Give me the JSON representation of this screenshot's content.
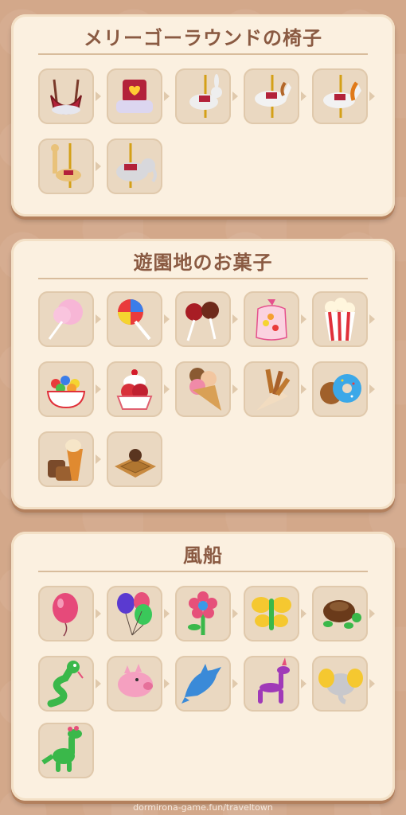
{
  "sections": [
    {
      "title": "メリーゴーラウンドの椅子",
      "items": [
        "swing-seat-icon",
        "heart-carriage-icon",
        "rabbit-carousel-icon",
        "white-horse-carousel-icon",
        "orange-horse-carousel-icon",
        "giraffe-carousel-icon",
        "elephant-carousel-icon"
      ]
    },
    {
      "title": "遊園地のお菓子",
      "items": [
        "cotton-candy-icon",
        "lollipop-icon",
        "candy-apple-icon",
        "candy-bag-icon",
        "popcorn-icon",
        "gumball-bowl-icon",
        "ice-cream-sundae-icon",
        "ice-cream-cone-icon",
        "churros-icon",
        "donut-icon",
        "waffle-cone-stack-icon",
        "waffle-icon"
      ]
    },
    {
      "title": "風船",
      "items": [
        "pink-balloon-icon",
        "balloon-bunch-icon",
        "balloon-flower-icon",
        "balloon-butterfly-icon",
        "balloon-turtle-icon",
        "balloon-snake-icon",
        "balloon-pig-icon",
        "balloon-dolphin-icon",
        "balloon-dog-icon",
        "balloon-elephant-icon",
        "balloon-dinosaur-icon"
      ]
    }
  ],
  "footer": "dormirona-game.fun/traveltown"
}
